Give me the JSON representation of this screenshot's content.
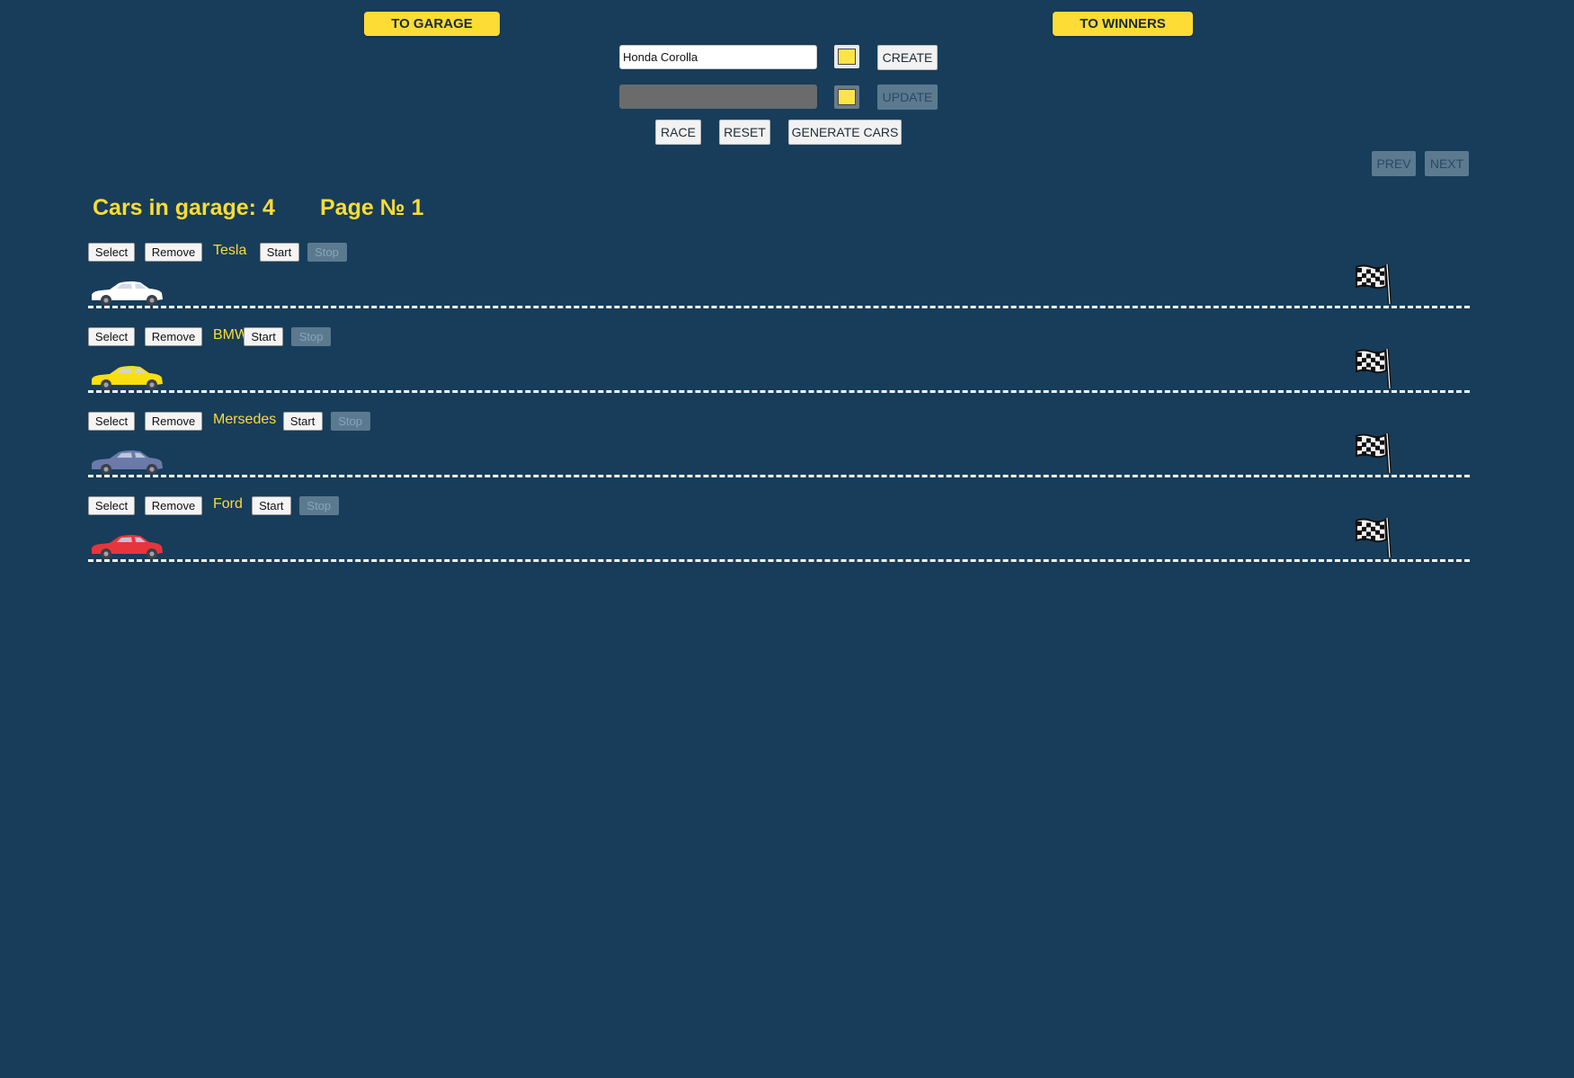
{
  "nav": {
    "to_garage": "TO GARAGE",
    "to_winners": "TO WINNERS"
  },
  "create": {
    "name_value": "Honda Corolla",
    "color": "#fde547",
    "button": "CREATE"
  },
  "update": {
    "name_value": "",
    "color": "#fde547",
    "button": "UPDATE"
  },
  "controls": {
    "race": "RACE",
    "reset": "RESET",
    "generate": "GENERATE CARS"
  },
  "pagination": {
    "prev": "PREV",
    "next": "NEXT"
  },
  "garage": {
    "count_text": "Cars in garage: 4",
    "page_text": "Page № 1"
  },
  "track_labels": {
    "select": "Select",
    "remove": "Remove",
    "start": "Start",
    "stop": "Stop"
  },
  "cars": [
    {
      "name": "Tesla",
      "color": "#ffffff"
    },
    {
      "name": "BMW",
      "color": "#f9df10"
    },
    {
      "name": "Mersedes",
      "color": "#6b7aa9"
    },
    {
      "name": "Ford",
      "color": "#e8353d"
    }
  ],
  "colors": {
    "background": "#173d5a",
    "accent": "#fddc35"
  }
}
